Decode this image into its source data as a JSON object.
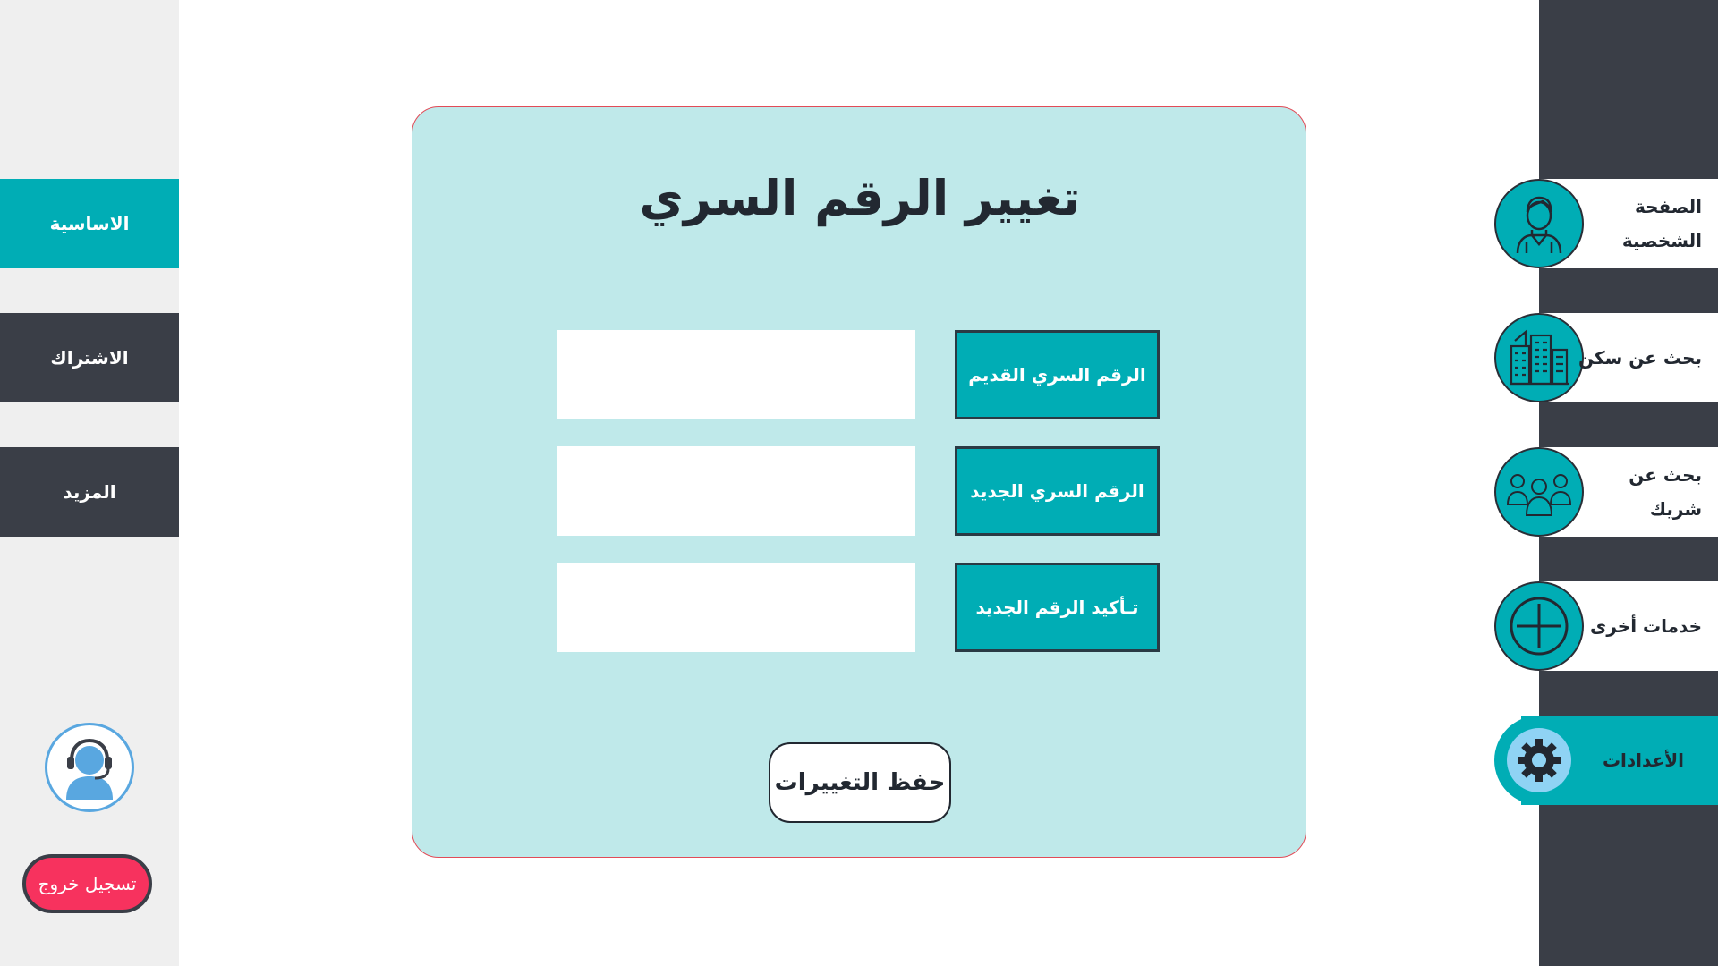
{
  "left_menu": {
    "items": [
      {
        "label": "الاساسية",
        "active": true
      },
      {
        "label": "الاشتراك",
        "active": false
      },
      {
        "label": "المزيد",
        "active": false
      }
    ],
    "logout_label": "تسجيل خروج"
  },
  "right_nav": {
    "items": [
      {
        "label": "الصفحة الشخصية",
        "icon": "user-icon"
      },
      {
        "label": "بحث عن سكن",
        "icon": "building-icon"
      },
      {
        "label": "بحث عن شريك",
        "icon": "group-icon"
      },
      {
        "label": "خدمات أخرى",
        "icon": "plus-icon"
      },
      {
        "label": "الأعدادات",
        "icon": "gear-icon",
        "active": true
      }
    ]
  },
  "form": {
    "title": "تغيير الرقم السري",
    "fields": [
      {
        "label": "الرقم السري القديم",
        "value": ""
      },
      {
        "label": "الرقم السري الجديد",
        "value": ""
      },
      {
        "label": "تـأكيد الرقم الجديد",
        "value": ""
      }
    ],
    "save_label": "حفظ التغييرات"
  },
  "colors": {
    "teal": "#00adb5",
    "dark": "#3a3e47",
    "card_bg": "#bfe9ea",
    "logout": "#f7325e"
  }
}
